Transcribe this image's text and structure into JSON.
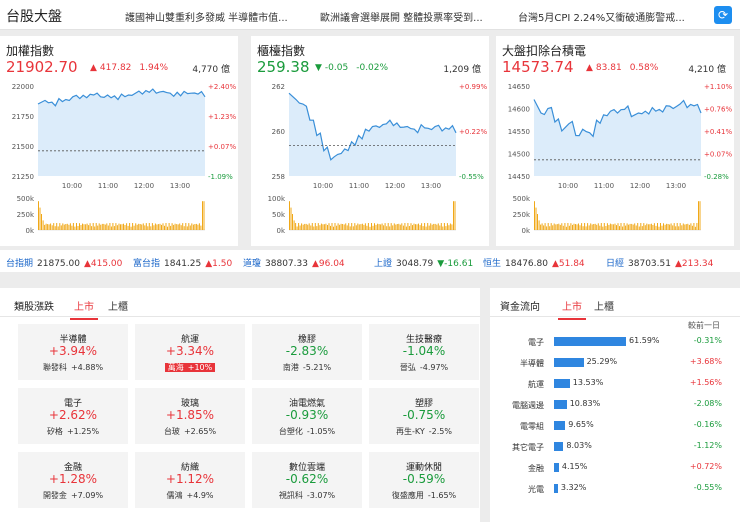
{
  "header": {
    "title": "台股大盤",
    "news": [
      "護國神山雙重利多發威 半導體市值...",
      "歐洲議會選舉展開 整體投票率受到...",
      "台灣5月CPI 2.24%又衝破通膨警戒..."
    ]
  },
  "panels": [
    {
      "name": "加權指數",
      "value": "21902.70",
      "arrow": "▲",
      "chg": "417.82",
      "pct": "1.94%",
      "vol": "4,770 億",
      "dir": "up",
      "ylabels": [
        "22000",
        "21750",
        "21500",
        "21250"
      ],
      "rlabels": [
        "+2.40%",
        "+1.23%",
        "+0.07%",
        "-1.09%"
      ],
      "xlabels": [
        "10:00",
        "11:00",
        "12:00",
        "13:00"
      ],
      "vlabels": [
        "500k",
        "250k",
        "0k"
      ]
    },
    {
      "name": "櫃檯指數",
      "value": "259.38",
      "arrow": "▼",
      "chg": "-0.05",
      "pct": "-0.02%",
      "vol": "1,209 億",
      "dir": "down",
      "ylabels": [
        "262",
        "260",
        "258"
      ],
      "rlabels": [
        "+0.99%",
        "+0.22%",
        "-0.55%"
      ],
      "xlabels": [
        "10:00",
        "11:00",
        "12:00",
        "13:00"
      ],
      "vlabels": [
        "100k",
        "50k",
        "0k"
      ]
    },
    {
      "name": "大盤扣除台積電",
      "value": "14573.74",
      "arrow": "▲",
      "chg": "83.81",
      "pct": "0.58%",
      "vol": "4,210 億",
      "dir": "up",
      "ylabels": [
        "14650",
        "14600",
        "14550",
        "14500",
        "14450"
      ],
      "rlabels": [
        "+1.10%",
        "+0.76%",
        "+0.41%",
        "+0.07%",
        "-0.28%"
      ],
      "xlabels": [
        "10:00",
        "11:00",
        "12:00",
        "13:00"
      ],
      "vlabels": [
        "500k",
        "250k",
        "0k"
      ]
    }
  ],
  "tickers": [
    {
      "name": "台指期",
      "value": "21875.00",
      "chg": "▲415.00",
      "dir": "up"
    },
    {
      "name": "富台指",
      "value": "1841.25",
      "chg": "▲1.50",
      "dir": "up"
    },
    {
      "name": "道瓊",
      "value": "38807.33",
      "chg": "▲96.04",
      "dir": "up"
    },
    {
      "name": "上證",
      "value": "3048.79",
      "chg": "▼-16.61",
      "dir": "down"
    },
    {
      "name": "恒生",
      "value": "18476.80",
      "chg": "▲51.84",
      "dir": "up"
    },
    {
      "name": "日經",
      "value": "38703.51",
      "chg": "▲213.34",
      "dir": "up"
    }
  ],
  "sectors": {
    "title": "類股漲跌",
    "tabs": [
      "上市",
      "上櫃"
    ],
    "cards": [
      {
        "name": "半導體",
        "value": "+3.94%",
        "stock": "聯發科",
        "schg": "+4.88%",
        "dir": "up",
        "hl": false
      },
      {
        "name": "航運",
        "value": "+3.34%",
        "stock": "萬海",
        "schg": "+10%",
        "dir": "up",
        "hl": true
      },
      {
        "name": "橡膠",
        "value": "-2.83%",
        "stock": "南港",
        "schg": "-5.21%",
        "dir": "down",
        "hl": false
      },
      {
        "name": "生技醫療",
        "value": "-1.04%",
        "stock": "晉弘",
        "schg": "-4.97%",
        "dir": "down",
        "hl": false
      },
      {
        "name": "電子",
        "value": "+2.62%",
        "stock": "矽格",
        "schg": "+1.25%",
        "dir": "up",
        "hl": false
      },
      {
        "name": "玻璃",
        "value": "+1.85%",
        "stock": "台玻",
        "schg": "+2.65%",
        "dir": "up",
        "hl": false
      },
      {
        "name": "油電燃氣",
        "value": "-0.93%",
        "stock": "台塑化",
        "schg": "-1.05%",
        "dir": "down",
        "hl": false
      },
      {
        "name": "塑膠",
        "value": "-0.75%",
        "stock": "再生-KY",
        "schg": "-2.5%",
        "dir": "down",
        "hl": false
      },
      {
        "name": "金融",
        "value": "+1.28%",
        "stock": "開發金",
        "schg": "+7.09%",
        "dir": "up",
        "hl": false
      },
      {
        "name": "紡織",
        "value": "+1.12%",
        "stock": "儒鴻",
        "schg": "+4.9%",
        "dir": "up",
        "hl": false
      },
      {
        "name": "數位雲端",
        "value": "-0.62%",
        "stock": "視訊科",
        "schg": "-3.07%",
        "dir": "down",
        "hl": false
      },
      {
        "name": "運動休閒",
        "value": "-0.59%",
        "stock": "復盛應用",
        "schg": "-1.65%",
        "dir": "down",
        "hl": false
      }
    ]
  },
  "flow": {
    "title": "資金流向",
    "tabs": [
      "上市",
      "上櫃"
    ],
    "header": "較前一日",
    "rows": [
      {
        "name": "電子",
        "pct": 61.59,
        "pct_label": "61.59%",
        "chg": "-0.31%",
        "dir": "down"
      },
      {
        "name": "半導體",
        "pct": 25.29,
        "pct_label": "25.29%",
        "chg": "+3.68%",
        "dir": "up"
      },
      {
        "name": "航運",
        "pct": 13.53,
        "pct_label": "13.53%",
        "chg": "+1.56%",
        "dir": "up"
      },
      {
        "name": "電腦週邊",
        "pct": 10.83,
        "pct_label": "10.83%",
        "chg": "-2.08%",
        "dir": "down"
      },
      {
        "name": "電零組",
        "pct": 9.65,
        "pct_label": "9.65%",
        "chg": "-0.16%",
        "dir": "down"
      },
      {
        "name": "其它電子",
        "pct": 8.03,
        "pct_label": "8.03%",
        "chg": "-1.12%",
        "dir": "down"
      },
      {
        "name": "金融",
        "pct": 4.15,
        "pct_label": "4.15%",
        "chg": "+0.72%",
        "dir": "up"
      },
      {
        "name": "光電",
        "pct": 3.32,
        "pct_label": "3.32%",
        "chg": "-0.55%",
        "dir": "down"
      }
    ]
  },
  "colors": {
    "up": "#e8343a",
    "down": "#1a9b3c",
    "line": "#3a8fd8",
    "fill": "#dcecfa",
    "volume": "#f0a818",
    "bar": "#2f86e0"
  }
}
